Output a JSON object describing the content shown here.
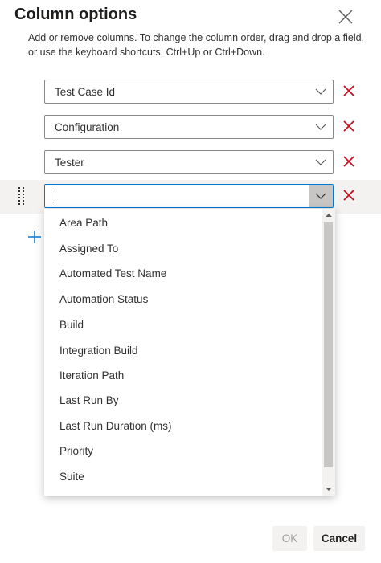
{
  "dialog": {
    "title": "Column options",
    "description": "Add or remove columns. To change the column order, drag and drop a field, or use the keyboard shortcuts, Ctrl+Up or Ctrl+Down."
  },
  "columns": [
    {
      "value": "Test Case Id"
    },
    {
      "value": "Configuration"
    },
    {
      "value": "Tester"
    },
    {
      "value": ""
    }
  ],
  "dropdown_options": [
    "Area Path",
    "Assigned To",
    "Automated Test Name",
    "Automation Status",
    "Build",
    "Integration Build",
    "Iteration Path",
    "Last Run By",
    "Last Run Duration (ms)",
    "Priority",
    "Suite"
  ],
  "footer": {
    "ok_label": "OK",
    "cancel_label": "Cancel"
  },
  "colors": {
    "accent": "#0078d4",
    "remove": "#c50f1f"
  },
  "icons": {
    "close": "close-icon",
    "chevron": "chevron-down-icon",
    "remove": "remove-icon",
    "add": "plus-icon",
    "drag": "drag-handle-icon"
  }
}
